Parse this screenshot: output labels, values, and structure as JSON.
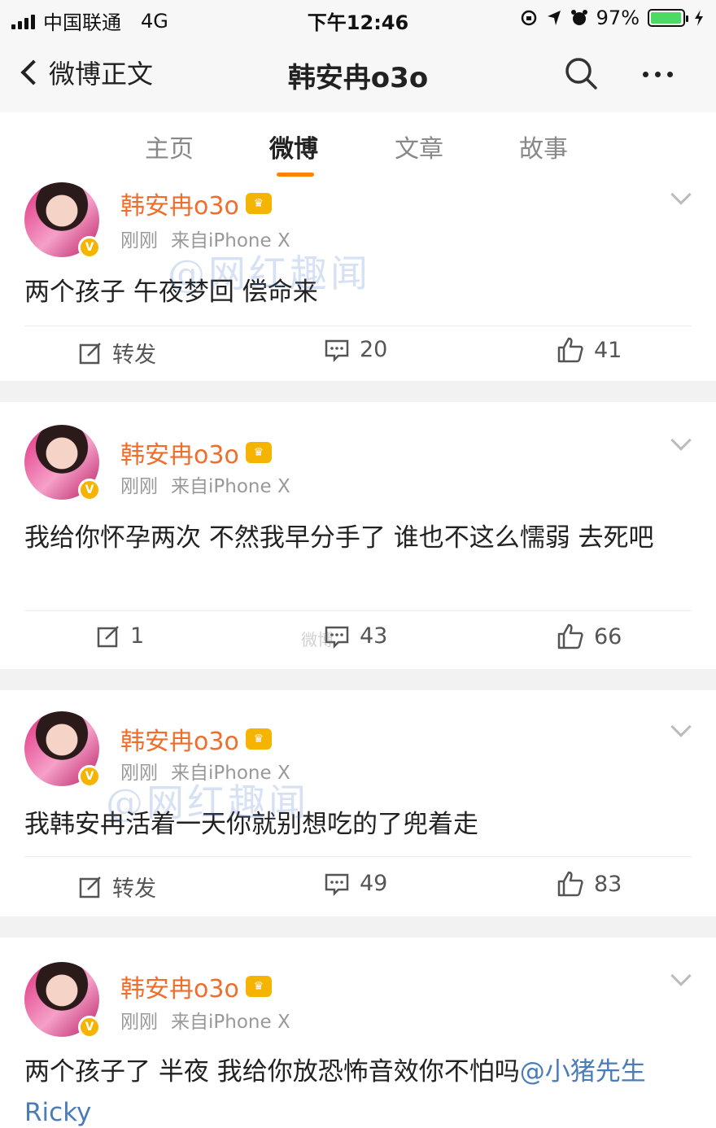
{
  "status_bar": {
    "carrier": "中国联通",
    "network": "4G",
    "time": "下午12:46",
    "battery_percent": "97%",
    "battery_level": 0.97
  },
  "nav": {
    "back_label": "微博正文",
    "title": "韩安冉o3o"
  },
  "tabs": [
    {
      "label": "主页",
      "active": false
    },
    {
      "label": "微博",
      "active": true
    },
    {
      "label": "文章",
      "active": false
    },
    {
      "label": "故事",
      "active": false
    }
  ],
  "accent_color": "#ff8200",
  "posts": [
    {
      "author": "韩安冉o3o",
      "time": "刚刚",
      "source": "来自iPhone X",
      "text": "两个孩子 午夜梦回 偿命来",
      "repost": "转发",
      "comments": "20",
      "likes": "41"
    },
    {
      "author": "韩安冉o3o",
      "time": "刚刚",
      "source": "来自iPhone X",
      "text": "我给你怀孕两次 不然我早分手了 谁也不这么懦弱 去死吧",
      "repost": "1",
      "comments": "43",
      "likes": "66"
    },
    {
      "author": "韩安冉o3o",
      "time": "刚刚",
      "source": "来自iPhone X",
      "text": "我韩安冉活着一天你就别想吃的了兜着走",
      "repost": "转发",
      "comments": "49",
      "likes": "83"
    },
    {
      "author": "韩安冉o3o",
      "time": "刚刚",
      "source": "来自iPhone X",
      "text": "两个孩子了 半夜 我给你放恐怖音效你不怕吗",
      "mention": "@小猪先生Ricky"
    }
  ],
  "watermarks": {
    "main": "@网红趣闻",
    "small": "微博"
  },
  "icons": {
    "back": "chevron-left-icon",
    "search": "search-icon",
    "more": "more-icon",
    "repost": "repost-icon",
    "comment": "comment-icon",
    "like": "thumbs-up-icon",
    "verified": "verified-badge-icon",
    "vip": "vip-crown-icon",
    "expand": "chevron-down-icon"
  }
}
